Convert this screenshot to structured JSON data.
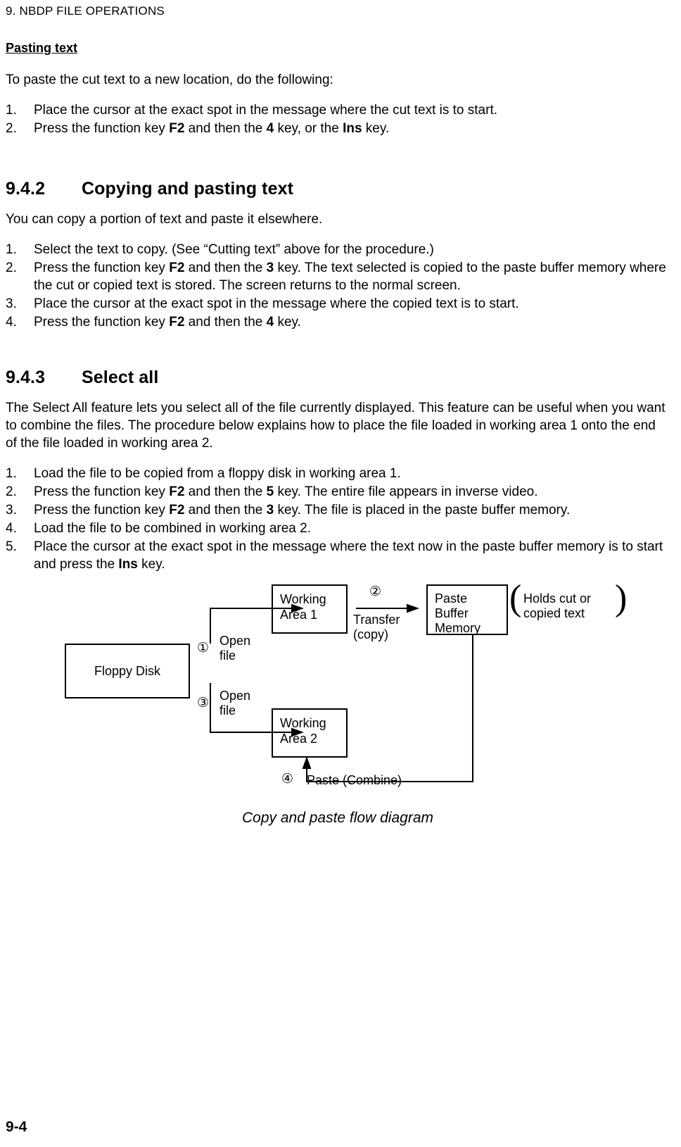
{
  "header": {
    "running_head": "9. NBDP FILE OPERATIONS"
  },
  "sections": {
    "pasting_text": {
      "heading": "Pasting text",
      "intro": "To paste the cut text to a new location, do the following:",
      "steps": [
        {
          "marker": "1.",
          "parts": [
            {
              "text": "Place the cursor at the exact spot in the message where the cut text is to start.",
              "bold": false
            }
          ]
        },
        {
          "marker": "2.",
          "parts": [
            {
              "text": "Press the function key ",
              "bold": false
            },
            {
              "text": "F2",
              "bold": true
            },
            {
              "text": " and then the ",
              "bold": false
            },
            {
              "text": "4",
              "bold": true
            },
            {
              "text": " key, or the ",
              "bold": false
            },
            {
              "text": "Ins",
              "bold": true
            },
            {
              "text": " key.",
              "bold": false
            }
          ]
        }
      ]
    },
    "copying": {
      "number": "9.4.2",
      "title": "Copying and pasting text",
      "intro": "You can copy a portion of text and paste it elsewhere.",
      "steps": [
        {
          "marker": "1.",
          "parts": [
            {
              "text": "Select the text to copy. (See “Cutting text” above for the procedure.)",
              "bold": false
            }
          ]
        },
        {
          "marker": "2.",
          "parts": [
            {
              "text": "Press the function key ",
              "bold": false
            },
            {
              "text": "F2",
              "bold": true
            },
            {
              "text": " and then the ",
              "bold": false
            },
            {
              "text": "3",
              "bold": true
            },
            {
              "text": " key. The text selected is copied to the paste buffer memory where the cut or copied text is stored. The screen returns to the normal screen.",
              "bold": false
            }
          ]
        },
        {
          "marker": "3.",
          "parts": [
            {
              "text": "Place the cursor at the exact spot in the message where the copied text is to start.",
              "bold": false
            }
          ]
        },
        {
          "marker": "4.",
          "parts": [
            {
              "text": "Press the function key ",
              "bold": false
            },
            {
              "text": "F2",
              "bold": true
            },
            {
              "text": " and then the ",
              "bold": false
            },
            {
              "text": "4",
              "bold": true
            },
            {
              "text": " key.",
              "bold": false
            }
          ]
        }
      ]
    },
    "select_all": {
      "number": "9.4.3",
      "title": "Select all",
      "intro": "The Select All feature lets you select all of the file currently displayed. This feature can be useful when you want to combine the files. The procedure below explains how to place the file loaded in working area 1 onto the end of the file loaded in working area 2.",
      "steps": [
        {
          "marker": "1.",
          "parts": [
            {
              "text": "Load the file to be copied from a floppy disk in working area 1.",
              "bold": false
            }
          ]
        },
        {
          "marker": "2.",
          "parts": [
            {
              "text": "Press the function key ",
              "bold": false
            },
            {
              "text": "F2",
              "bold": true
            },
            {
              "text": " and then the ",
              "bold": false
            },
            {
              "text": "5",
              "bold": true
            },
            {
              "text": " key. The entire file appears in inverse video.",
              "bold": false
            }
          ]
        },
        {
          "marker": "3.",
          "parts": [
            {
              "text": "Press the function key ",
              "bold": false
            },
            {
              "text": "F2",
              "bold": true
            },
            {
              "text": " and then the ",
              "bold": false
            },
            {
              "text": "3",
              "bold": true
            },
            {
              "text": " key. The file is placed in the paste buffer memory.",
              "bold": false
            }
          ]
        },
        {
          "marker": "4.",
          "parts": [
            {
              "text": "Load the file to be combined in working area 2.",
              "bold": false
            }
          ]
        },
        {
          "marker": "5.",
          "parts": [
            {
              "text": "Place the cursor at the exact spot in the message where the text now in the paste buffer memory is to start and press the ",
              "bold": false
            },
            {
              "text": "Ins",
              "bold": true
            },
            {
              "text": " key.",
              "bold": false
            }
          ]
        }
      ]
    }
  },
  "diagram": {
    "caption": "Copy and paste flow diagram",
    "boxes": {
      "floppy_disk": "Floppy Disk",
      "working_area_1": "Working\nArea 1",
      "working_area_2": "Working\nArea 2",
      "paste_buffer": "Paste\nBuffer\nMemory"
    },
    "labels": {
      "open_file_1": "Open\nfile",
      "open_file_2": "Open\nfile",
      "transfer": "Transfer\n(copy)",
      "paste_combine": "Paste (Combine)",
      "holds_note": "Holds cut or\ncopied text"
    },
    "markers": {
      "one": "①",
      "two": "②",
      "three": "③",
      "four": "④"
    }
  },
  "footer": {
    "page_number": "9-4"
  }
}
